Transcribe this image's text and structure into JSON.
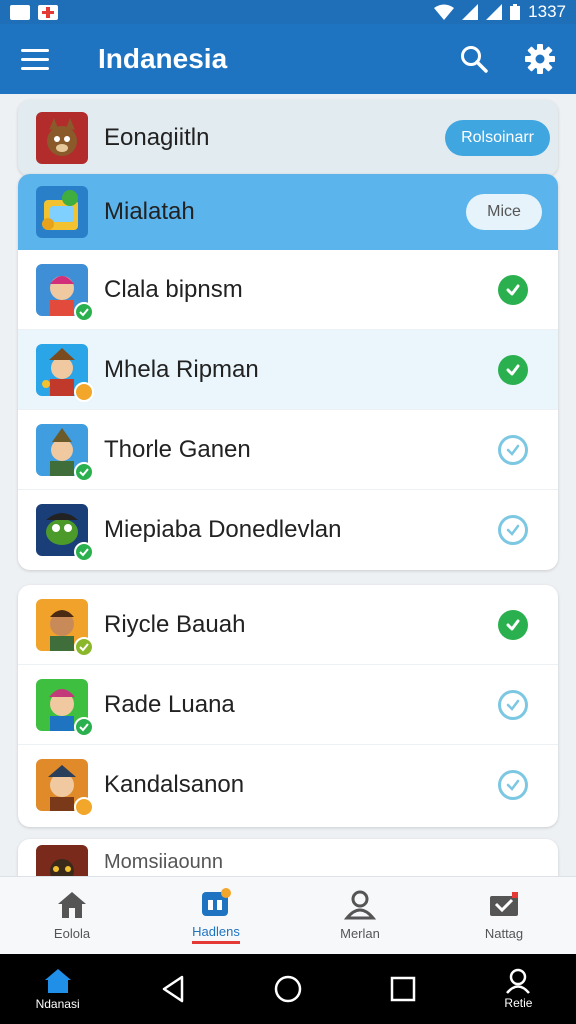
{
  "status_bar": {
    "time": "1337"
  },
  "app_bar": {
    "title": "Indanesia"
  },
  "header_row": {
    "name": "Eonagiitln",
    "button": "Rolsoinarr"
  },
  "group": {
    "header": {
      "name": "Mialatah",
      "button": "Mice"
    },
    "items": [
      {
        "name": "Clala bipnsm",
        "checked": true
      },
      {
        "name": "Mhela Ripman",
        "checked": true
      },
      {
        "name": "Thorle Ganen",
        "checked": false
      },
      {
        "name": "Miepiaba Donedlevlan",
        "checked": false
      }
    ]
  },
  "group2": {
    "items": [
      {
        "name": "Riycle Bauah",
        "checked": true
      },
      {
        "name": "Rade Luana",
        "checked": false
      },
      {
        "name": "Kandalsanon",
        "checked": false
      }
    ]
  },
  "partial_row": {
    "name": "Momsiiaounn"
  },
  "bottom_nav": [
    {
      "label": "Eolola",
      "icon": "home-icon"
    },
    {
      "label": "Hadlens",
      "icon": "apps-icon",
      "active": true
    },
    {
      "label": "Merlan",
      "icon": "person-icon"
    },
    {
      "label": "Nattag",
      "icon": "mail-icon"
    }
  ],
  "system_nav": {
    "home_label": "Ndanasi",
    "profile_label": "Retie"
  },
  "colors": {
    "primary": "#1f74c2",
    "accent_check": "#2bb04f",
    "light_check": "#7cc7e2",
    "section_header": "#5bb4ec"
  }
}
